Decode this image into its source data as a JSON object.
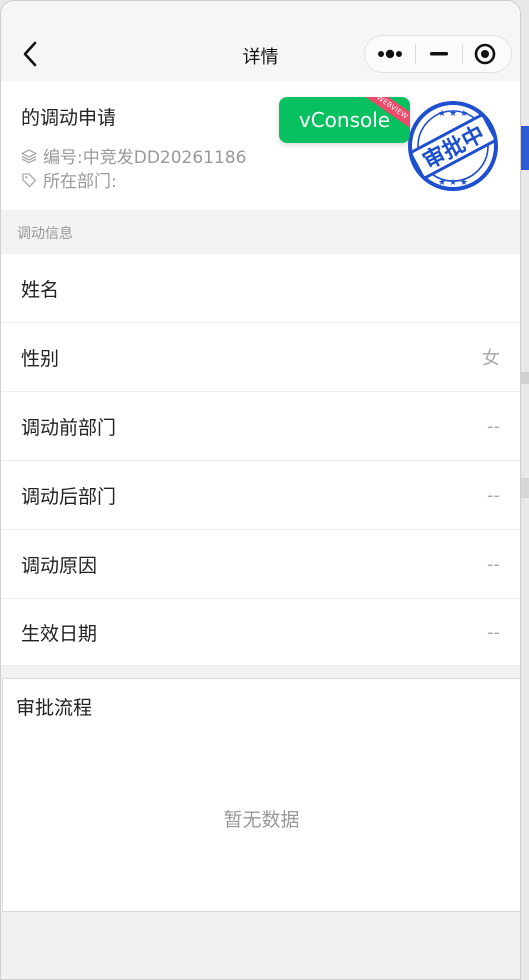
{
  "nav": {
    "title": "详情"
  },
  "header": {
    "title": "的调动申请",
    "code_label": "编号:",
    "code_value": "中竞发DD20261186",
    "dept_label": "所在部门:",
    "dept_value": "",
    "stamp_text": "审批中",
    "stamp_color": "#1f4fd1"
  },
  "vconsole": {
    "label": "vConsole",
    "ribbon": "WEBVIEW",
    "color": "#07c160"
  },
  "section": {
    "label": "调动信息"
  },
  "info_rows": [
    {
      "label": "姓名",
      "value": ""
    },
    {
      "label": "性别",
      "value": "女"
    },
    {
      "label": "调动前部门",
      "value": "--"
    },
    {
      "label": "调动后部门",
      "value": "--"
    },
    {
      "label": "调动原因",
      "value": "--"
    },
    {
      "label": "生效日期",
      "value": "--"
    }
  ],
  "flow": {
    "title": "审批流程",
    "empty_text": "暂无数据"
  },
  "icons": {
    "back": "chevron-left-icon",
    "more": "more-dots-icon",
    "minimize": "minimize-icon",
    "close": "target-close-icon",
    "layers": "layers-icon",
    "tag": "tag-icon"
  }
}
